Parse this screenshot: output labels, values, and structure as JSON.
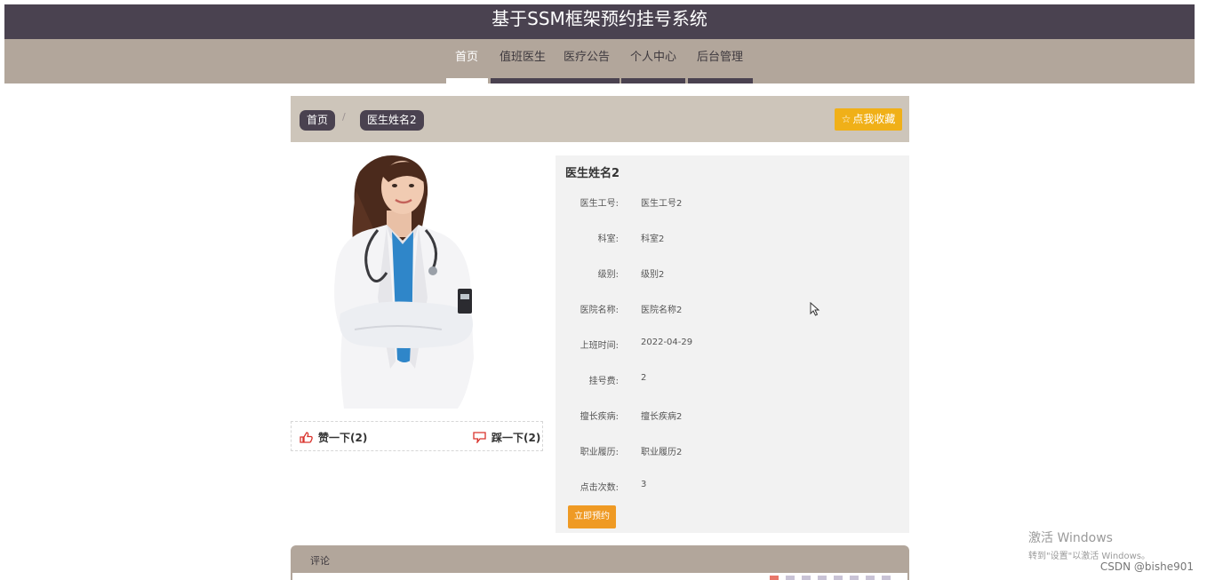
{
  "header": {
    "title": "基于SSM框架预约挂号系统"
  },
  "nav": {
    "items": [
      {
        "label": "首页",
        "active": true
      },
      {
        "label": "值班医生",
        "active": false
      },
      {
        "label": "医疗公告",
        "active": false
      },
      {
        "label": "个人中心",
        "active": false
      },
      {
        "label": "后台管理",
        "active": false
      }
    ]
  },
  "breadcrumb": {
    "home": "首页",
    "separator": "/",
    "current": "医生姓名2"
  },
  "favorite": {
    "icon": "star-icon",
    "label": "点我收藏"
  },
  "votes": {
    "like_icon": "thumbs-up-icon",
    "like_label": "赞一下(2)",
    "dislike_icon": "thumbs-down-icon",
    "dislike_label": "踩一下(2)"
  },
  "doctor": {
    "name": "医生姓名2",
    "fields": [
      {
        "label": "医生工号:",
        "value": "医生工号2"
      },
      {
        "label": "科室:",
        "value": "科室2"
      },
      {
        "label": "级别:",
        "value": "级别2"
      },
      {
        "label": "医院名称:",
        "value": "医院名称2"
      },
      {
        "label": "上班时间:",
        "value": "2022-04-29"
      },
      {
        "label": "挂号费:",
        "value": "2"
      },
      {
        "label": "擅长疾病:",
        "value": "擅长疾病2"
      },
      {
        "label": "职业履历:",
        "value": "职业履历2"
      },
      {
        "label": "点击次数:",
        "value": "3"
      }
    ],
    "book_label": "立即预约"
  },
  "comments": {
    "title": "评论"
  },
  "watermark": {
    "title": "激活 Windows",
    "subtitle": "转到\"设置\"以激活 Windows。"
  },
  "credit": "CSDN @bishe901",
  "colors": {
    "header_bg": "#4a4250",
    "nav_bg": "#b2a69b",
    "breadcrumb_bg": "#cdc5ba",
    "favorite": "#f0b018",
    "book": "#ef9a24"
  }
}
